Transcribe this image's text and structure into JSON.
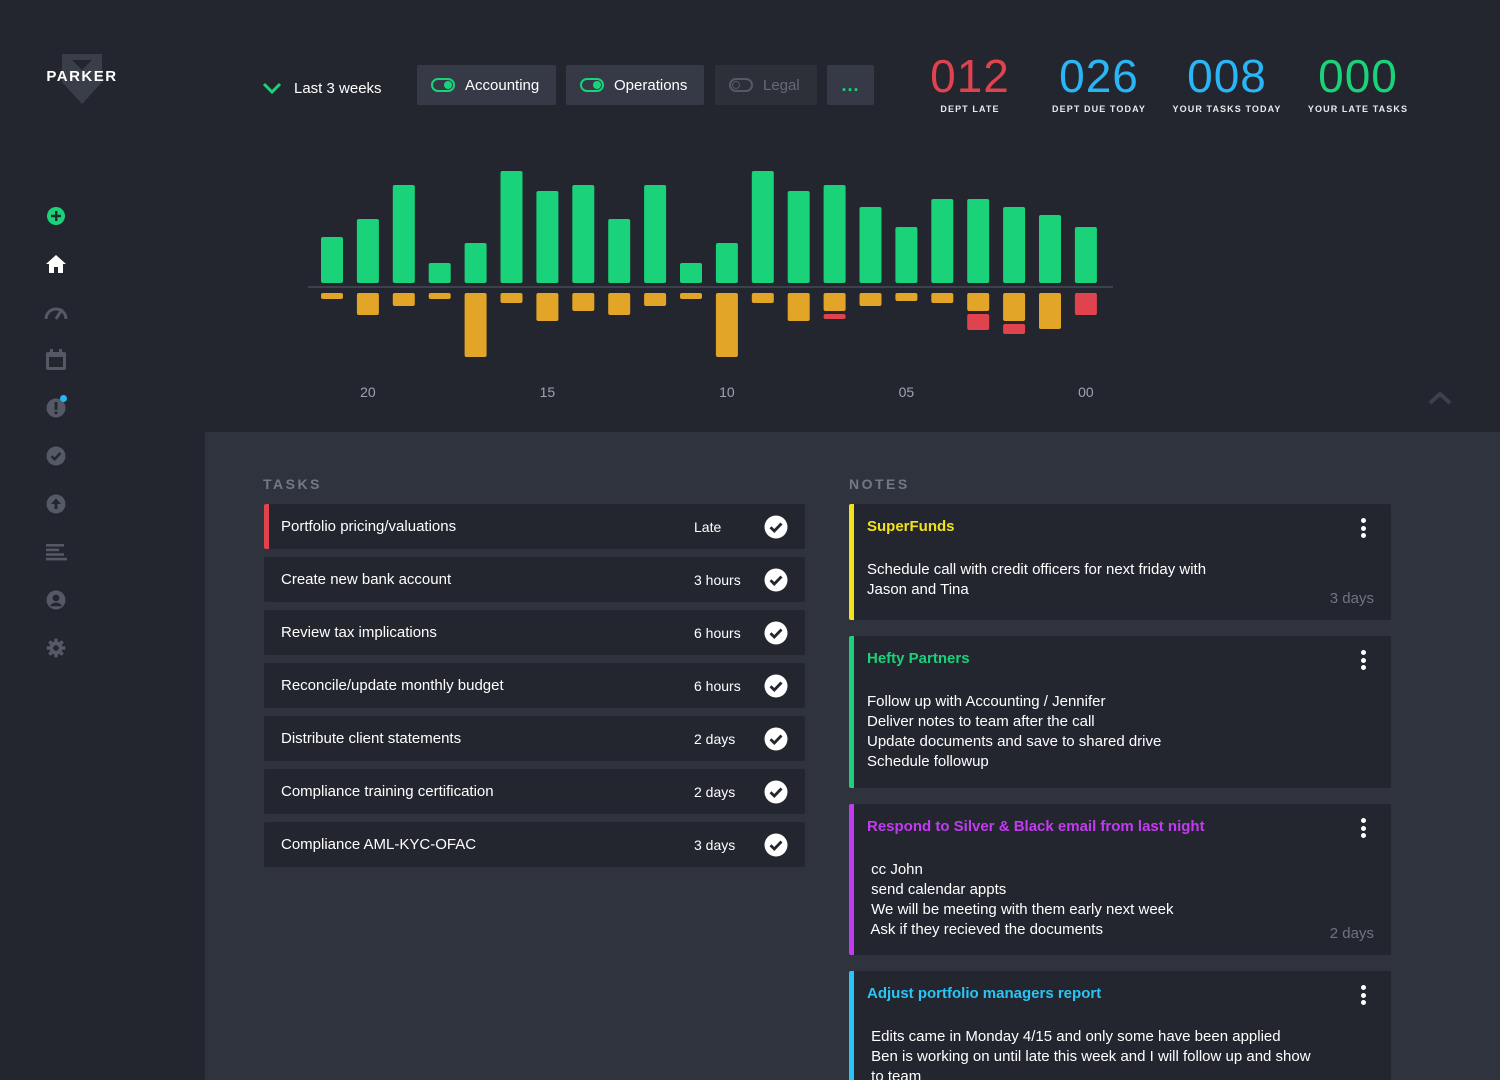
{
  "brand": {
    "name": "PARKER"
  },
  "sidebar": {
    "items": [
      {
        "icon": "add-circle-icon",
        "color": "#19d27a"
      },
      {
        "icon": "home-icon",
        "color": "#ffffff"
      },
      {
        "icon": "speedometer-icon",
        "color": "#555965"
      },
      {
        "icon": "calendar-icon",
        "color": "#555965"
      },
      {
        "icon": "alert-icon",
        "color": "#555965",
        "badge": true
      },
      {
        "icon": "check-circle-icon",
        "color": "#555965"
      },
      {
        "icon": "upload-icon",
        "color": "#555965"
      },
      {
        "icon": "list-icon",
        "color": "#555965"
      },
      {
        "icon": "user-icon",
        "color": "#555965"
      },
      {
        "icon": "gear-icon",
        "color": "#555965"
      }
    ]
  },
  "filters": {
    "range_label": "Last 3 weeks",
    "departments": [
      {
        "label": "Accounting",
        "enabled": true
      },
      {
        "label": "Operations",
        "enabled": true
      },
      {
        "label": "Legal",
        "enabled": false
      }
    ],
    "more_label": "..."
  },
  "stats": [
    {
      "value": "012",
      "label": "DEPT LATE",
      "color": "#e0434e"
    },
    {
      "value": "026",
      "label": "DEPT DUE TODAY",
      "color": "#28b6f6"
    },
    {
      "value": "008",
      "label": "YOUR TASKS TODAY",
      "color": "#28b6f6"
    },
    {
      "value": "000",
      "label": "YOUR LATE TASKS",
      "color": "#19d27a"
    }
  ],
  "chart_data": {
    "type": "bar",
    "x_ticks": [
      "20",
      "15",
      "10",
      "05",
      "00"
    ],
    "series": [
      {
        "color": "#19d27a",
        "values": [
          46,
          64,
          98,
          20,
          40,
          112,
          92,
          98,
          64,
          98,
          20,
          40,
          112,
          92,
          98,
          76,
          56,
          84,
          84,
          76,
          68,
          56
        ]
      },
      {
        "color": "#e3a527",
        "values": [
          -6,
          -22,
          -13,
          -6,
          -64,
          -10,
          -28,
          -18,
          -22,
          -13,
          -6,
          -64,
          -10,
          -28,
          -18,
          -13,
          -8,
          -10,
          -18,
          -28,
          -36,
          0
        ]
      },
      {
        "color": "#e0434e",
        "values": [
          0,
          0,
          0,
          0,
          0,
          0,
          0,
          0,
          0,
          0,
          0,
          0,
          0,
          0,
          -5,
          0,
          0,
          0,
          -16,
          -10,
          0,
          -22
        ]
      }
    ],
    "colors": {
      "positive": "#19d27a",
      "negative": "#e3a527",
      "late": "#e0434e"
    }
  },
  "tasks": {
    "title": "TASKS",
    "items": [
      {
        "name": "Portfolio pricing/valuations",
        "due": "Late",
        "late": true
      },
      {
        "name": "Create new bank account",
        "due": "3 hours",
        "late": false
      },
      {
        "name": "Review tax implications",
        "due": "6 hours",
        "late": false
      },
      {
        "name": "Reconcile/update monthly budget",
        "due": "6 hours",
        "late": false
      },
      {
        "name": "Distribute client statements",
        "due": "2 days",
        "late": false
      },
      {
        "name": "Compliance training certification",
        "due": "2 days",
        "late": false
      },
      {
        "name": "Compliance AML-KYC-OFAC",
        "due": "3 days",
        "late": false
      }
    ]
  },
  "notes": {
    "title": "NOTES",
    "items": [
      {
        "title": "SuperFunds",
        "color": "#f2e21b",
        "age": "3 days",
        "lines": [
          "Schedule call with credit officers for next friday with",
          "Jason and Tina"
        ]
      },
      {
        "title": "Hefty Partners",
        "color": "#19d27a",
        "age": "",
        "lines": [
          "Follow up with Accounting / Jennifer",
          "Deliver notes to team after the call",
          "Update documents and save to shared drive",
          "Schedule followup"
        ]
      },
      {
        "title": "Respond to Silver & Black email from last night",
        "color": "#c13cf0",
        "age": "2 days",
        "lines": [
          " cc John",
          " send calendar appts",
          " We will be meeting with them early next week",
          " Ask if they recieved the documents"
        ]
      },
      {
        "title": "Adjust portfolio managers report",
        "color": "#28c5f6",
        "age": "",
        "lines": [
          " Edits came in Monday 4/15 and only some have been applied",
          " Ben is working on until late this week and I will follow up and show",
          " to team"
        ]
      }
    ]
  }
}
